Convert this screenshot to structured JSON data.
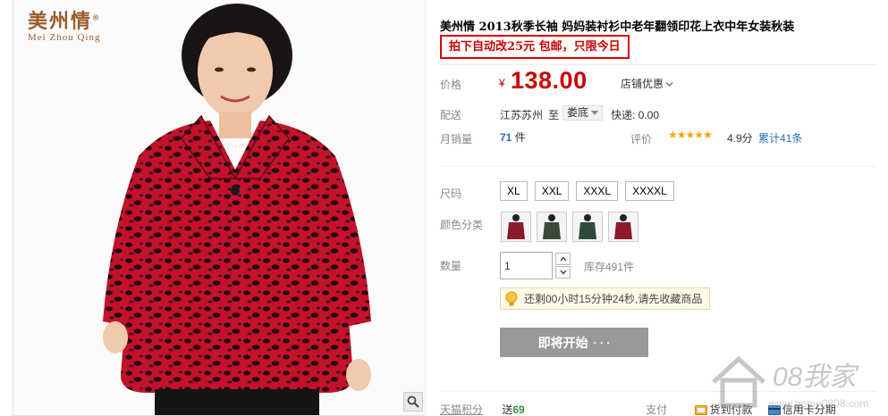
{
  "brand": {
    "name_cn": "美州情",
    "reg_mark": "®",
    "name_en": "Mei Zhou Qing"
  },
  "product": {
    "title": "美州情 2013秋季长袖 妈妈装衬衫中老年翻领印花上衣中年女装秋装",
    "promo": "拍下自动改25元 包邮，只限今日"
  },
  "price": {
    "label": "价格",
    "symbol": "¥",
    "value": "138.00",
    "shop_promo": "店铺优惠"
  },
  "shipping": {
    "label": "配送",
    "from": "江苏苏州",
    "to_word": "至",
    "destination": "娄底",
    "fee": "快递: 0.00"
  },
  "sales": {
    "label": "月销量",
    "count": "71",
    "unit": "件",
    "rating_label": "评价",
    "stars": "★★★★★",
    "score": "4.9分",
    "reviews": "累计41条"
  },
  "size": {
    "label": "尺码",
    "options": [
      "XL",
      "XXL",
      "XXXL",
      "XXXXL"
    ]
  },
  "color": {
    "label": "颜色分类",
    "swatch_colors": [
      "#8b1a2a",
      "#3a4a3a",
      "#2f4a3c",
      "#8a1a2c"
    ]
  },
  "quantity": {
    "label": "数量",
    "value": "1",
    "stock": "库存491件"
  },
  "notice": {
    "text": "还剩00小时15分钟24秒,请先收藏商品"
  },
  "buy_button": {
    "label": "即将开始",
    "dots": "· · ·"
  },
  "footer": {
    "points_label": "天猫积分",
    "points_prefix": "送",
    "points_value": "69",
    "pay_label": "支付",
    "cod": "货到付款",
    "installment": "信用卡分期"
  },
  "watermark": {
    "text": "08我家",
    "url": "www.home0808.com"
  },
  "colors": {
    "price_red": "#cc0000",
    "accent_blue": "#2a6db0",
    "promo_border": "#dd0000",
    "star": "#f5a30a",
    "button_gray": "#999999"
  }
}
